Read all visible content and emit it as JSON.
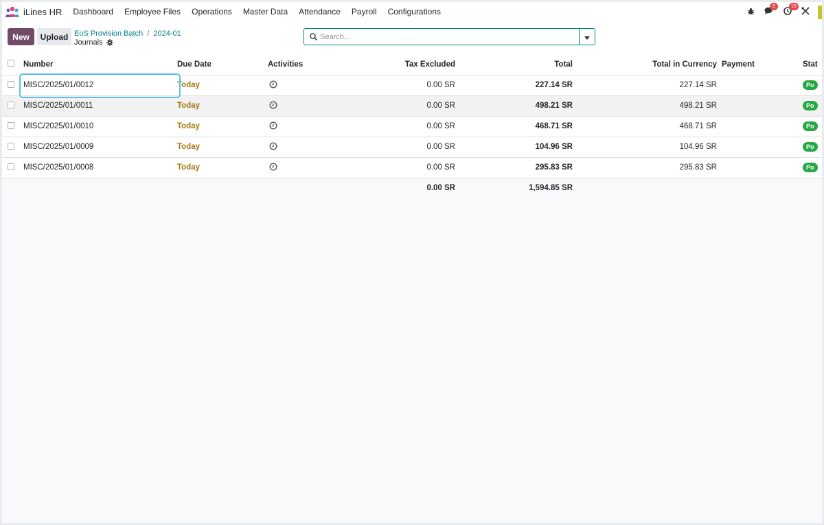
{
  "navbar": {
    "app_name": "iLines HR",
    "menu": [
      "Dashboard",
      "Employee Files",
      "Operations",
      "Master Data",
      "Attendance",
      "Payroll",
      "Configurations"
    ],
    "messages_count": "5",
    "activities_count": "15"
  },
  "control_panel": {
    "new_label": "New",
    "upload_label": "Upload",
    "breadcrumb": [
      "EoS Provision Batch",
      "2024-01"
    ],
    "breadcrumb_sep": "/",
    "current_title": "Journals",
    "search_placeholder": "Search..."
  },
  "table": {
    "columns": {
      "number": "Number",
      "due_date": "Due Date",
      "activities": "Activities",
      "tax_excluded": "Tax Excluded",
      "total": "Total",
      "total_in_currency": "Total in Currency",
      "payment": "Payment",
      "status": "Stat"
    },
    "rows": [
      {
        "number": "MISC/2025/01/0012",
        "due_date": "Today",
        "tax_excluded": "0.00 SR",
        "total": "227.14 SR",
        "total_in_currency": "227.14 SR",
        "payment": "",
        "status": "Po"
      },
      {
        "number": "MISC/2025/01/0011",
        "due_date": "Today",
        "tax_excluded": "0.00 SR",
        "total": "498.21 SR",
        "total_in_currency": "498.21 SR",
        "payment": "",
        "status": "Po"
      },
      {
        "number": "MISC/2025/01/0010",
        "due_date": "Today",
        "tax_excluded": "0.00 SR",
        "total": "468.71 SR",
        "total_in_currency": "468.71 SR",
        "payment": "",
        "status": "Po"
      },
      {
        "number": "MISC/2025/01/0009",
        "due_date": "Today",
        "tax_excluded": "0.00 SR",
        "total": "104.96 SR",
        "total_in_currency": "104.96 SR",
        "payment": "",
        "status": "Po"
      },
      {
        "number": "MISC/2025/01/0008",
        "due_date": "Today",
        "tax_excluded": "0.00 SR",
        "total": "295.83 SR",
        "total_in_currency": "295.83 SR",
        "payment": "",
        "status": "Po"
      }
    ],
    "footer": {
      "tax_excluded": "0.00 SR",
      "total": "1,594.85 SR"
    }
  },
  "colors": {
    "primary": "#714b67",
    "link": "#017e84",
    "due_today": "#a0780e",
    "status_posted": "#28a745",
    "badge": "#e24b4b"
  },
  "icons": [
    "app-logo-icon",
    "bug-icon",
    "chat-icon",
    "clock-icon",
    "tools-icon",
    "gear-icon",
    "search-icon",
    "caret-down-icon"
  ]
}
